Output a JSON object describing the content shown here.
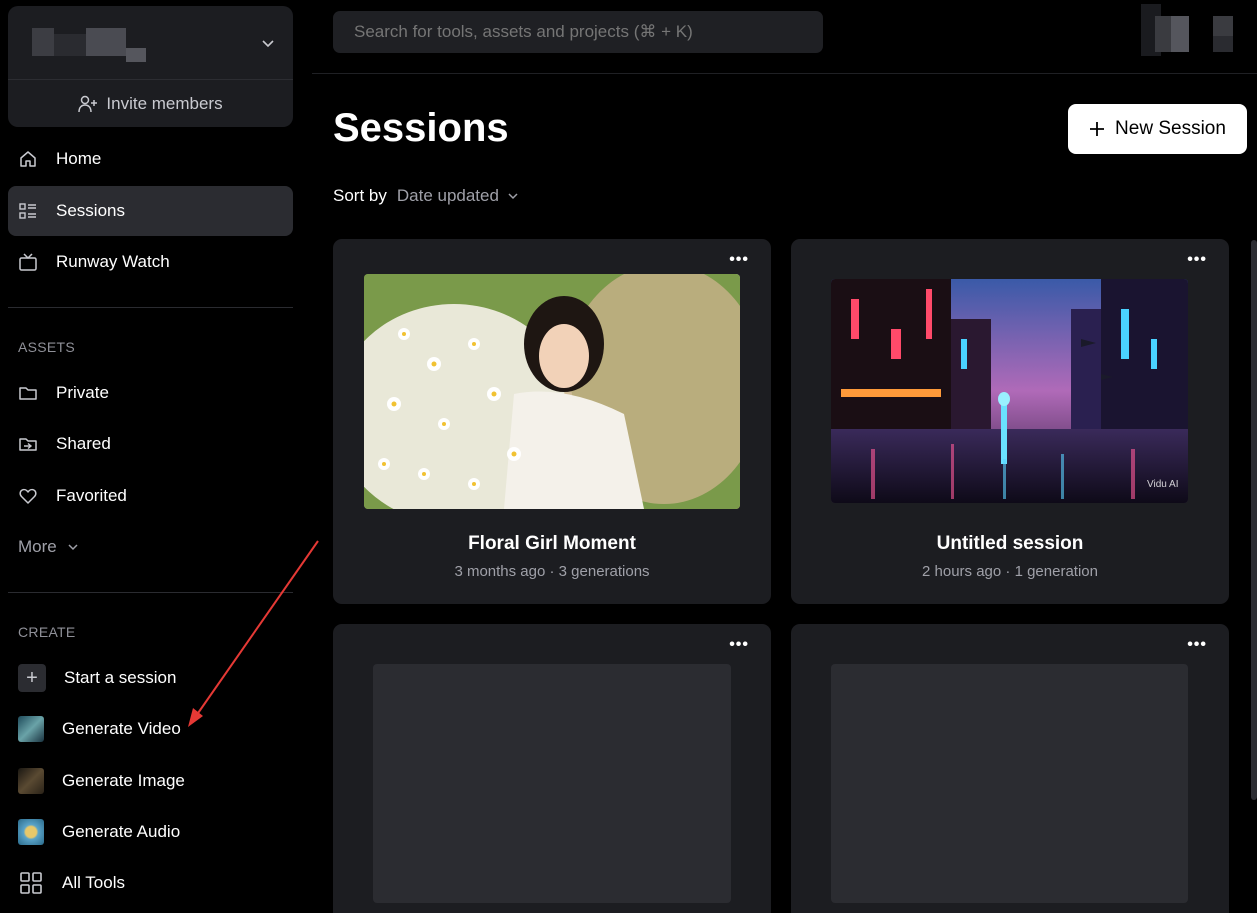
{
  "workspace": {
    "invite_label": "Invite members"
  },
  "nav": {
    "home": "Home",
    "sessions": "Sessions",
    "runway_watch": "Runway Watch"
  },
  "assets": {
    "section_label": "ASSETS",
    "private": "Private",
    "shared": "Shared",
    "favorited": "Favorited",
    "more": "More"
  },
  "create": {
    "section_label": "CREATE",
    "start_session": "Start a session",
    "generate_video": "Generate Video",
    "generate_image": "Generate Image",
    "generate_audio": "Generate Audio",
    "all_tools": "All Tools"
  },
  "search": {
    "placeholder": "Search for tools, assets and projects (⌘ + K)"
  },
  "main": {
    "title": "Sessions",
    "new_session_label": "New Session",
    "sort_label": "Sort by",
    "sort_value": "Date updated"
  },
  "sessions": [
    {
      "title": "Floral Girl Moment",
      "meta": "3 months ago · 3 generations"
    },
    {
      "title": "Untitled session",
      "meta": "2 hours ago · 1 generation",
      "watermark": "Vidu AI"
    },
    {
      "title": "",
      "meta": ""
    },
    {
      "title": "",
      "meta": ""
    }
  ],
  "colors": {
    "background": "#000000",
    "panel": "#1c1d21",
    "active": "#2b2c31",
    "muted_text": "#9fa0a8",
    "annotation_arrow": "#e53935"
  }
}
